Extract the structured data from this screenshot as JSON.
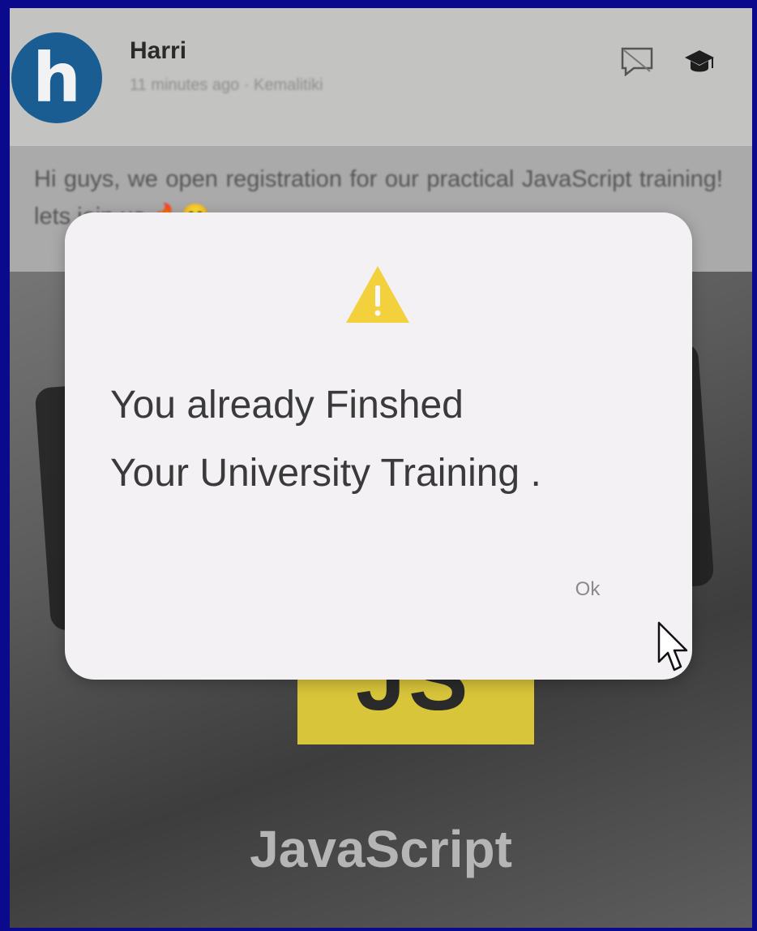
{
  "post": {
    "avatar_letter": "h",
    "author": "Harri",
    "meta": "11 minutes ago · Kemalitiki",
    "text": "Hi guys, we open registration for our practical JavaScript training! lets join us 🔥😊"
  },
  "icons": {
    "chat": "chat-bubble-icon",
    "graduation": "graduation-cap-icon",
    "warning": "warning-icon",
    "cursor": "mouse-pointer-icon"
  },
  "image": {
    "badge_text": "JS",
    "caption": "JavaScript"
  },
  "dialog": {
    "message_line1": "You already Finshed",
    "message_line2": "Your University Training .",
    "ok_label": "Ok"
  },
  "colors": {
    "frame_border": "#0c0a8c",
    "avatar": "#1a5d93",
    "warning": "#f2d13c",
    "js_badge": "#d8c53a"
  }
}
